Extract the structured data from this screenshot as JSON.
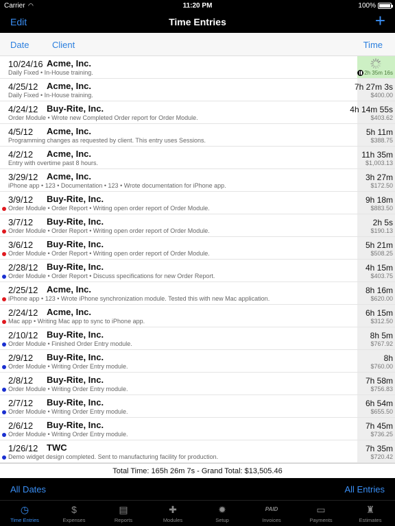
{
  "status": {
    "carrier": "Carrier",
    "time": "11:20 PM",
    "battery": "100%"
  },
  "nav": {
    "edit": "Edit",
    "title": "Time Entries",
    "add": "+"
  },
  "columns": {
    "date": "Date",
    "client": "Client",
    "time": "Time"
  },
  "entries": [
    {
      "date": "10/24/16",
      "client": "Acme, Inc.",
      "desc": "Daily Fixed • In-House training.",
      "duration": "",
      "amount": "",
      "dot": "",
      "running": true,
      "runtime": "2h 35m 16s"
    },
    {
      "date": "4/25/12",
      "client": "Acme, Inc.",
      "desc": "Daily Fixed • In-House training.",
      "duration": "7h 27m 3s",
      "amount": "$400.00",
      "dot": ""
    },
    {
      "date": "4/24/12",
      "client": "Buy-Rite, Inc.",
      "desc": "Order Module • Wrote new Completed Order report for Order Module.",
      "duration": "4h 14m 55s",
      "amount": "$403.62",
      "dot": ""
    },
    {
      "date": "4/5/12",
      "client": "Acme, Inc.",
      "desc": "Programming changes as requested by client.  This entry uses Sessions.",
      "duration": "5h 11m",
      "amount": "$388.75",
      "dot": ""
    },
    {
      "date": "4/2/12",
      "client": "Acme, Inc.",
      "desc": "Entry with overtime past 8 hours.",
      "duration": "11h 35m",
      "amount": "$1,003.13",
      "dot": ""
    },
    {
      "date": "3/29/12",
      "client": "Acme, Inc.",
      "desc": "iPhone app • 123 • Documentation • 123 • Wrote documentation for iPhone app.",
      "duration": "3h 27m",
      "amount": "$172.50",
      "dot": ""
    },
    {
      "date": "3/9/12",
      "client": "Buy-Rite, Inc.",
      "desc": "Order Module • Order Report • Writing open order report of Order Module.",
      "duration": "9h 18m",
      "amount": "$883.50",
      "dot": "#e0191f"
    },
    {
      "date": "3/7/12",
      "client": "Buy-Rite, Inc.",
      "desc": "Order Module • Order Report • Writing open order report of Order Module.",
      "duration": "2h 5s",
      "amount": "$190.13",
      "dot": "#e0191f"
    },
    {
      "date": "3/6/12",
      "client": "Buy-Rite, Inc.",
      "desc": "Order Module • Order Report • Writing open order report of Order Module.",
      "duration": "5h 21m",
      "amount": "$508.25",
      "dot": "#e0191f"
    },
    {
      "date": "2/28/12",
      "client": "Buy-Rite, Inc.",
      "desc": "Order Module • Order Report • Discuss specifications for new Order Report.",
      "duration": "4h 15m",
      "amount": "$403.75",
      "dot": "#1a2fd0"
    },
    {
      "date": "2/25/12",
      "client": "Acme, Inc.",
      "desc": "iPhone app • 123 • Wrote iPhone synchronization module.  Tested this with new Mac application.",
      "duration": "8h 16m",
      "amount": "$620.00",
      "dot": "#e0191f"
    },
    {
      "date": "2/24/12",
      "client": "Acme, Inc.",
      "desc": "Mac app • Writing Mac app to sync to iPhone app.",
      "duration": "6h 15m",
      "amount": "$312.50",
      "dot": "#e0191f"
    },
    {
      "date": "2/10/12",
      "client": "Buy-Rite, Inc.",
      "desc": "Order Module • Finished Order Entry module.",
      "duration": "8h 5m",
      "amount": "$767.92",
      "dot": "#1a2fd0"
    },
    {
      "date": "2/9/12",
      "client": "Buy-Rite, Inc.",
      "desc": "Order Module • Writing Order Entry module.",
      "duration": "8h",
      "amount": "$760.00",
      "dot": "#1a2fd0"
    },
    {
      "date": "2/8/12",
      "client": "Buy-Rite, Inc.",
      "desc": "Order Module • Writing Order Entry module.",
      "duration": "7h 58m",
      "amount": "$756.83",
      "dot": "#1a2fd0"
    },
    {
      "date": "2/7/12",
      "client": "Buy-Rite, Inc.",
      "desc": "Order Module • Writing Order Entry module.",
      "duration": "6h 54m",
      "amount": "$655.50",
      "dot": "#1a2fd0"
    },
    {
      "date": "2/6/12",
      "client": "Buy-Rite, Inc.",
      "desc": "Order Module • Writing Order Entry module.",
      "duration": "7h 45m",
      "amount": "$736.25",
      "dot": "#1a2fd0"
    },
    {
      "date": "1/26/12",
      "client": "TWC",
      "desc": "Demo widget design completed.  Sent to manufacturing facility for production.",
      "duration": "7h 35m",
      "amount": "$720.42",
      "dot": "#1a2fd0"
    }
  ],
  "total": "Total Time: 165h 26m 7s - Grand Total: $13,505.46",
  "filters": {
    "dates": "All Dates",
    "entries": "All Entries"
  },
  "tabs": [
    {
      "label": "Time Entries",
      "icon": "clock-icon",
      "glyph": "◷",
      "active": true
    },
    {
      "label": "Expenses",
      "icon": "dollar-icon",
      "glyph": "$"
    },
    {
      "label": "Reports",
      "icon": "report-icon",
      "glyph": "▤"
    },
    {
      "label": "Modules",
      "icon": "puzzle-icon",
      "glyph": "✚"
    },
    {
      "label": "Setup",
      "icon": "gear-icon",
      "glyph": "✹"
    },
    {
      "label": "Invoices",
      "icon": "paid-stamp-icon",
      "glyph": "PAID"
    },
    {
      "label": "Payments",
      "icon": "card-icon",
      "glyph": "▭"
    },
    {
      "label": "Estimates",
      "icon": "stamp-icon",
      "glyph": "♜"
    }
  ],
  "colors": {
    "accent": "#3a8ff5",
    "running": "#cdf0c4",
    "red_dot": "#e0191f",
    "blue_dot": "#1a2fd0"
  }
}
